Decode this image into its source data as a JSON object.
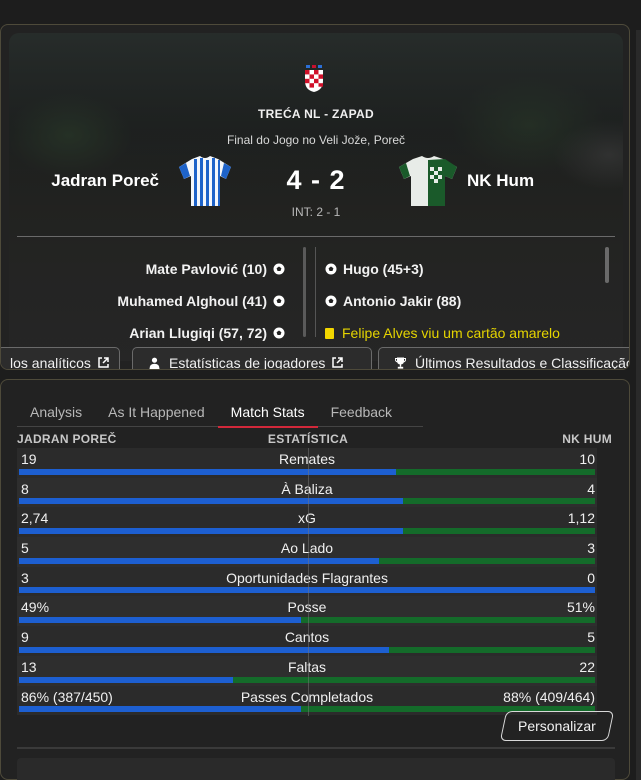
{
  "match": {
    "competition": "TREĆA NL - ZAPAD",
    "venue": "Final do Jogo no Veli Jože, Poreč",
    "home_team": "Jadran Poreč",
    "away_team": "NK Hum",
    "score": "4 - 2",
    "halftime": "INT: 2 - 1",
    "home_goals": [
      "Mate Pavlović (10)",
      "Muhamed Alghoul (41)",
      "Arian Llugiqi (57, 72)"
    ],
    "away_goals": [
      "Hugo (45+3)",
      "Antonio Jakir (88)"
    ],
    "away_card": "Felipe Alves viu um cartão amarelo"
  },
  "actions": {
    "analytics": "los analíticos",
    "player_stats": "Estatísticas de jogadores",
    "results": "Últimos Resultados e Classificação"
  },
  "tabs": [
    "Analysis",
    "As It Happened",
    "Match Stats",
    "Feedback"
  ],
  "active_tab": "Match Stats",
  "stats_header": {
    "home": "JADRAN POREČ",
    "label": "ESTATÍSTICA",
    "away": "NK HUM"
  },
  "stats": [
    {
      "label": "Remates",
      "home": "19",
      "away": "10",
      "home_frac": 0.655
    },
    {
      "label": "À Baliza",
      "home": "8",
      "away": "4",
      "home_frac": 0.667
    },
    {
      "label": "xG",
      "home": "2,74",
      "away": "1,12",
      "home_frac": 0.667
    },
    {
      "label": "Ao Lado",
      "home": "5",
      "away": "3",
      "home_frac": 0.625
    },
    {
      "label": "Oportunidades Flagrantes",
      "home": "3",
      "away": "0",
      "home_frac": 1.0
    },
    {
      "label": "Posse",
      "home": "49%",
      "away": "51%",
      "home_frac": 0.49
    },
    {
      "label": "Cantos",
      "home": "9",
      "away": "5",
      "home_frac": 0.643
    },
    {
      "label": "Faltas",
      "home": "13",
      "away": "22",
      "home_frac": 0.371
    },
    {
      "label": "Passes Completados",
      "home": "86% (387/450)",
      "away": "88% (409/464)",
      "home_frac": 0.49
    }
  ],
  "customize_label": "Personalizar",
  "colors": {
    "home_bar": "#1d5fd1",
    "away_bar": "#146b2a",
    "active_tab": "#d2283a",
    "card": "#f2d600"
  }
}
